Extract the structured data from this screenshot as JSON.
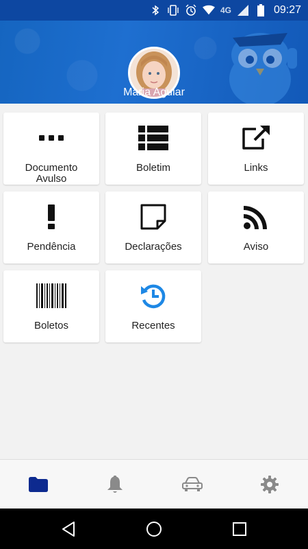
{
  "status_bar": {
    "network": "4G",
    "time": "09:27",
    "icons": [
      "bluetooth-icon",
      "vibrate-icon",
      "alarm-icon",
      "wifi-icon",
      "signal-icon",
      "battery-icon"
    ]
  },
  "header": {
    "user_name": "Maria Aguiar",
    "accent_color": "#1565c0"
  },
  "menu": {
    "items": [
      {
        "label": "Documento\nAvulso",
        "icon": "more-horizontal-icon"
      },
      {
        "label": "Boletim",
        "icon": "list-icon"
      },
      {
        "label": "Links",
        "icon": "external-link-icon"
      },
      {
        "label": "Pendência",
        "icon": "exclamation-icon"
      },
      {
        "label": "Declarações",
        "icon": "sticky-note-icon"
      },
      {
        "label": "Aviso",
        "icon": "rss-icon"
      },
      {
        "label": "Boletos",
        "icon": "barcode-icon"
      },
      {
        "label": "Recentes",
        "icon": "history-icon"
      }
    ]
  },
  "bottom_nav": {
    "items": [
      {
        "icon": "folder-icon",
        "active": true
      },
      {
        "icon": "bell-icon",
        "active": false
      },
      {
        "icon": "car-icon",
        "active": false
      },
      {
        "icon": "gear-icon",
        "active": false
      }
    ],
    "active_color": "#0d2a8f",
    "inactive_color": "#8a8a8a"
  }
}
